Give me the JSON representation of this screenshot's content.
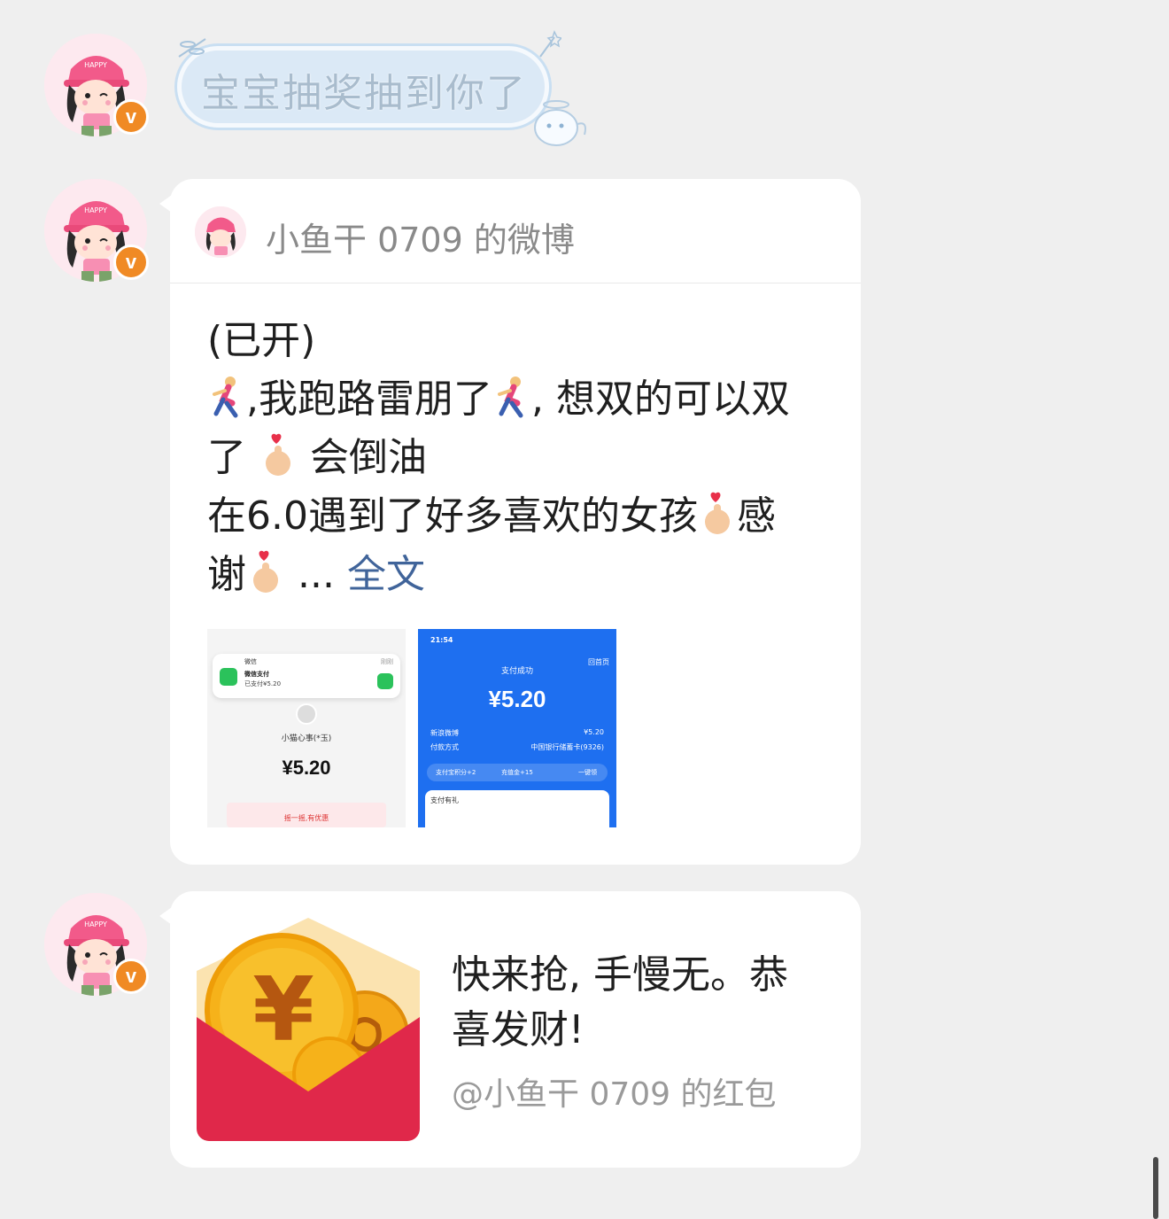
{
  "messages": {
    "greeting": {
      "text": "宝宝抽奖抽到你了"
    },
    "weibo_share": {
      "source": "小鱼干 0709 的微博",
      "body_lines": [
        "(已开)",
        "🏃,我跑路雷朋了🏃,想双的可以双",
        "了🫰会倒油",
        "在6.0遇到了好多喜欢的女孩🫰感",
        "谢🫰..."
      ],
      "line1": "(已开)",
      "line2a": "我跑路雷朋了",
      "line2b": "想双的可以双",
      "line3a": "了",
      "line3b": "会倒油",
      "line4a": "在6.0遇到了好多喜欢的女孩",
      "line4b": "感",
      "line5a": "谢",
      "line5b": "...",
      "full_text_link": "全文",
      "images": {
        "thumb1": {
          "notif_app": "微信",
          "notif_time": "刚刚",
          "notif_title": "微信支付",
          "notif_detail": "已支付¥5.20",
          "payee": "小猫心事(*玉)",
          "amount": "¥5.20",
          "promo": "摇一摇,有优惠"
        },
        "thumb2": {
          "time": "21:54",
          "back": "回首页",
          "status": "支付成功",
          "amount": "¥5.20",
          "merchant_label": "新浪微博",
          "merchant_amount": "¥5.20",
          "method_label": "付款方式",
          "method_value": "中国银行储蓄卡(9326)",
          "reward1": "支付宝积分+2",
          "reward2": "充值金+15",
          "reward_btn": "一键领",
          "gift": "支付有礼"
        }
      }
    },
    "red_packet": {
      "text_line1": "快来抢, 手慢无。恭",
      "text_line2": "喜发财!",
      "from": "@小鱼干 0709 的红包"
    }
  },
  "colors": {
    "background": "#efefef",
    "bubble_blue": "#dbe9f6",
    "link_blue": "#40649a",
    "verified_orange": "#f08a24",
    "packet_red": "#e0284a",
    "coin_gold": "#f6b21a",
    "alipay_blue": "#1e6ff0"
  }
}
